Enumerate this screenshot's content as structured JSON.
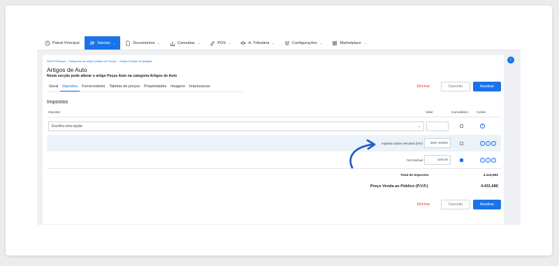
{
  "navbar": {
    "items": [
      {
        "label": "Painel Principal",
        "icon": "clock-icon",
        "caret": false,
        "active": false
      },
      {
        "label": "Tabelas",
        "icon": "users-icon",
        "caret": true,
        "active": true
      },
      {
        "label": "Documentos",
        "icon": "document-icon",
        "caret": true,
        "active": false
      },
      {
        "label": "Consultas",
        "icon": "bar-chart-icon",
        "caret": true,
        "active": false
      },
      {
        "label": "POS",
        "icon": "pos-icon",
        "caret": true,
        "active": false
      },
      {
        "label": "A. Tributária",
        "icon": "scale-icon",
        "caret": true,
        "active": false
      },
      {
        "label": "Configurações",
        "icon": "sliders-icon",
        "caret": true,
        "active": false
      },
      {
        "label": "Marketplace",
        "icon": "grid-icon",
        "caret": true,
        "active": false
      }
    ]
  },
  "breadcrumb": {
    "items": [
      "Painel Principal",
      "Categorias de artigos [Artigos de Peças]",
      "Artigos [Carpas de garagis]"
    ]
  },
  "page": {
    "title": "Artigos de Auto",
    "subtitle": "Nesta secção pode alterar o artigo Peças Auto na categoria Artigos de Auto"
  },
  "tabs": [
    {
      "label": "Geral",
      "active": false
    },
    {
      "label": "Impostos",
      "active": true
    },
    {
      "label": "Fornecedores",
      "active": false
    },
    {
      "label": "Tabelas de preços",
      "active": false
    },
    {
      "label": "Propriedades",
      "active": false
    },
    {
      "label": "Imagens",
      "active": false
    },
    {
      "label": "Impressoras",
      "active": false
    }
  ],
  "actions": {
    "delete_label": "Eliminar",
    "cancel_label": "Cancelar",
    "update_label": "Atualizar"
  },
  "taxes": {
    "section_title": "Impostos",
    "headers": {
      "tax": "Imposto",
      "value": "Valor",
      "cumulative": "Cumulativo",
      "actions": "Ações"
    },
    "select_placeholder": "Escolha uma opção",
    "rows": [
      {
        "label": "Imposto sobre veículos (ISV)",
        "value": "3587,00000",
        "cumulative": false
      },
      {
        "label": "IVA Normal",
        "value": "828,69",
        "cumulative": true
      }
    ]
  },
  "totals": {
    "total_label": "Total de Impostos",
    "total_value": "4.415,69€",
    "pvp_label": "Preço Venda ao Público (P.V.P.)",
    "pvp_value": "4.431,68€"
  },
  "colors": {
    "accent": "#1a73e8",
    "danger": "#e53935",
    "highlight_row": "#eaf3f9"
  }
}
